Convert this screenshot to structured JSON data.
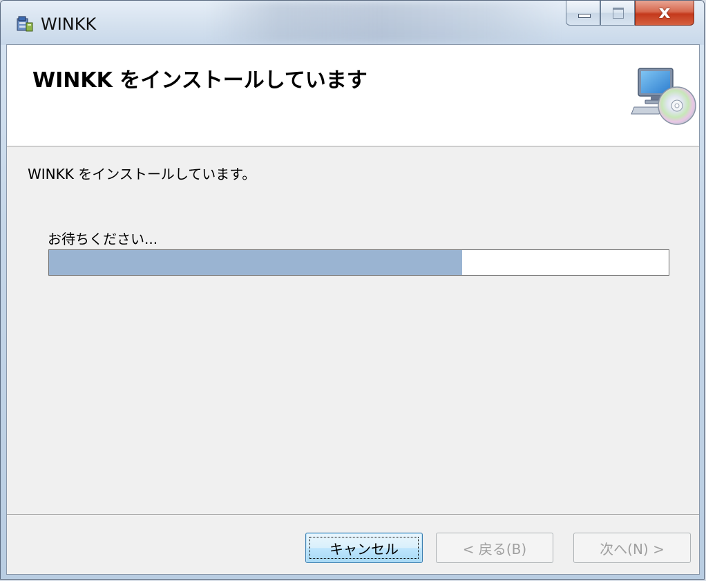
{
  "window": {
    "title": "WINKK"
  },
  "header": {
    "title": "WINKK をインストールしています"
  },
  "body": {
    "status": "WINKK をインストールしています。",
    "wait": "お待ちください...",
    "progress": 0.667
  },
  "buttons": {
    "cancel": "キャンセル",
    "back": "< 戻る(B)",
    "next": "次へ(N) >"
  },
  "colors": {
    "progress_fill": "#9ab4d2",
    "close_button": "#c4391c"
  },
  "icons": {
    "app": "installer-icon",
    "header": "computer-disc-icon"
  }
}
